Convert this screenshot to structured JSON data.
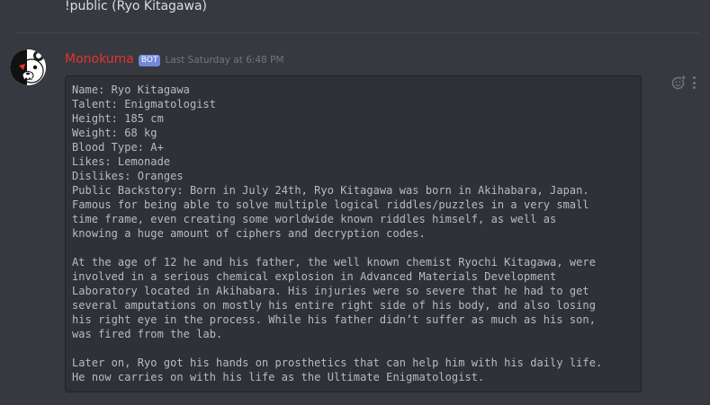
{
  "previous_message": {
    "text": "!public (Ryo Kitagawa)"
  },
  "message": {
    "author": "Monokuma",
    "author_color": "#e3342f",
    "bot_tag": "BOT",
    "timestamp": "Last Saturday at 6:48 PM",
    "avatar_icon": "monokuma-bear-avatar",
    "code_block": "Name: Ryo Kitagawa\nTalent: Enigmatologist\nHeight: 185 cm\nWeight: 68 kg\nBlood Type: A+\nLikes: Lemonade\nDislikes: Oranges\nPublic Backstory: Born in July 24th, Ryo Kitagawa was born in Akihabara, Japan.\nFamous for being able to solve multiple logical riddles/puzzles in a very small\ntime frame, even creating some worldwide known riddles himself, as well as\nknowing a huge amount of ciphers and decryption codes.\n\nAt the age of 12 he and his father, the well known chemist Ryochi Kitagawa, were\ninvolved in a serious chemical explosion in Advanced Materials Development\nLaboratory located in Akihabara. His injuries were so severe that he had to get\nseveral amputations on mostly his entire right side of his body, and also losing\nhis right eye in the process. While his father didn’t suffer as much as his son,\nwas fired from the lab.\n\nLater on, Ryo got his hands on prosthetics that can help him with his daily life.\nHe now carries on with his life as the Ultimate Enigmatologist."
  },
  "actions": {
    "react_icon": "add-reaction-icon",
    "more_icon": "more-options-icon"
  },
  "colors": {
    "background": "#36393f",
    "code_background": "#2f3136",
    "bot_tag": "#7289da",
    "timestamp": "#72767d"
  }
}
